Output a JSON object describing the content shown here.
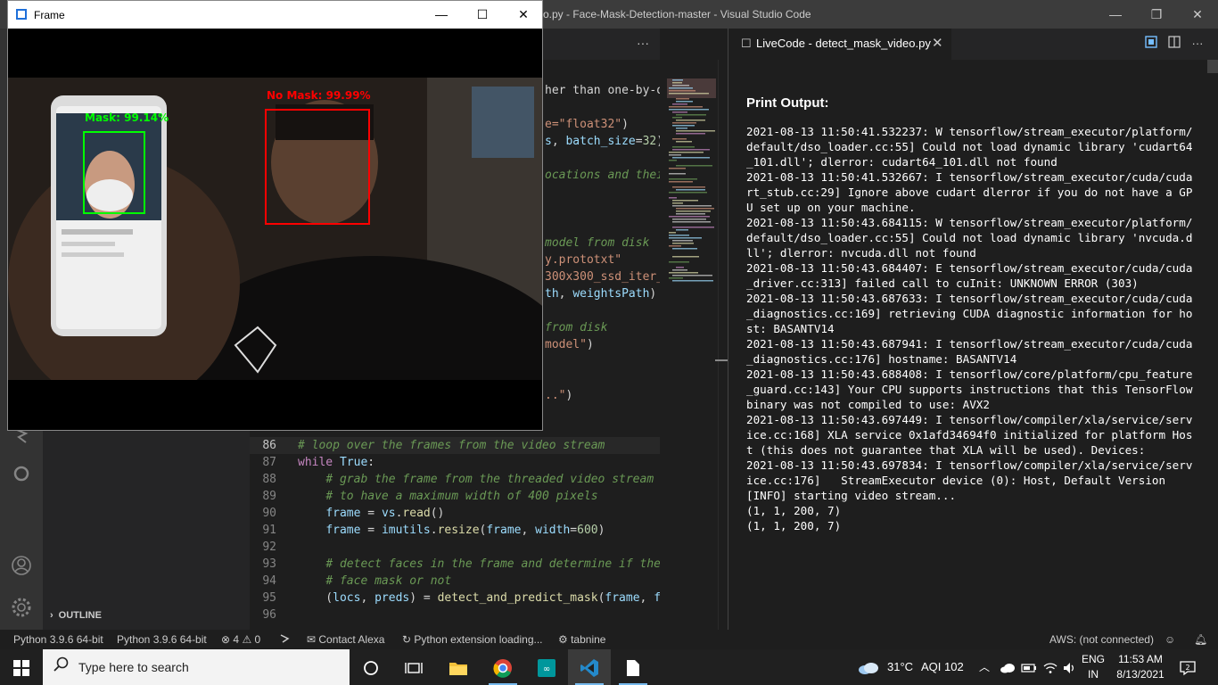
{
  "vscode": {
    "title": "o.py - Face-Mask-Detection-master - Visual Studio Code",
    "window_controls": {
      "minimize": "—",
      "restore": "❐",
      "close": "✕"
    }
  },
  "frame_window": {
    "title": "Frame",
    "controls": {
      "minimize": "—",
      "maximize": "☐",
      "close": "✕"
    },
    "detections": [
      {
        "label": "Mask: 99.14%",
        "color": "#00ff00"
      },
      {
        "label": "No Mask: 99.99%",
        "color": "#ff0000"
      }
    ]
  },
  "editor": {
    "more_actions": "···",
    "hidden_fragments": [
      {
        "parts": [
          [
            "p",
            "her than one-by-o"
          ]
        ]
      },
      {
        "parts": [
          [
            "s",
            "e=\"float32\""
          ],
          [
            "p",
            ")"
          ]
        ]
      },
      {
        "parts": [
          [
            "v",
            "s"
          ],
          [
            "p",
            ", "
          ],
          [
            "v",
            "batch_size"
          ],
          [
            "p",
            "="
          ],
          [
            "n",
            "32"
          ],
          [
            "p",
            ")"
          ]
        ]
      },
      {
        "parts": [
          [
            "c",
            "ocations and thei"
          ]
        ]
      },
      {
        "parts": [
          [
            "c",
            "model from disk"
          ]
        ]
      },
      {
        "parts": [
          [
            "s",
            "y.prototxt\""
          ]
        ]
      },
      {
        "parts": [
          [
            "s",
            "300x300_ssd_iter_"
          ]
        ]
      },
      {
        "parts": [
          [
            "v",
            "th"
          ],
          [
            "p",
            ", "
          ],
          [
            "v",
            "weightsPath"
          ],
          [
            "p",
            ")"
          ]
        ]
      },
      {
        "parts": [
          [
            "c",
            "from disk"
          ]
        ]
      },
      {
        "parts": [
          [
            "s",
            "model\""
          ],
          [
            "p",
            ")"
          ]
        ]
      },
      {
        "parts": [
          [
            "s",
            "..\""
          ],
          [
            "p",
            ")"
          ]
        ]
      }
    ],
    "lines": [
      {
        "num": "86",
        "parts": [
          [
            "c",
            "# loop over the frames from the video stream"
          ]
        ]
      },
      {
        "num": "87",
        "parts": [
          [
            "k",
            "while"
          ],
          [
            "p",
            " "
          ],
          [
            "v",
            "True"
          ],
          [
            "p",
            ":"
          ]
        ]
      },
      {
        "num": "88",
        "parts": [
          [
            "p",
            "    "
          ],
          [
            "c",
            "# grab the frame from the threaded video stream a"
          ]
        ]
      },
      {
        "num": "89",
        "parts": [
          [
            "p",
            "    "
          ],
          [
            "c",
            "# to have a maximum width of 400 pixels"
          ]
        ]
      },
      {
        "num": "90",
        "parts": [
          [
            "p",
            "    "
          ],
          [
            "v",
            "frame"
          ],
          [
            "p",
            " = "
          ],
          [
            "v",
            "vs"
          ],
          [
            "p",
            "."
          ],
          [
            "f",
            "read"
          ],
          [
            "p",
            "()"
          ]
        ]
      },
      {
        "num": "91",
        "parts": [
          [
            "p",
            "    "
          ],
          [
            "v",
            "frame"
          ],
          [
            "p",
            " = "
          ],
          [
            "v",
            "imutils"
          ],
          [
            "p",
            "."
          ],
          [
            "f",
            "resize"
          ],
          [
            "p",
            "("
          ],
          [
            "v",
            "frame"
          ],
          [
            "p",
            ", "
          ],
          [
            "v",
            "width"
          ],
          [
            "p",
            "="
          ],
          [
            "n",
            "600"
          ],
          [
            "p",
            ")"
          ]
        ]
      },
      {
        "num": "92",
        "parts": []
      },
      {
        "num": "93",
        "parts": [
          [
            "p",
            "    "
          ],
          [
            "c",
            "# detect faces in the frame and determine if they"
          ]
        ]
      },
      {
        "num": "94",
        "parts": [
          [
            "p",
            "    "
          ],
          [
            "c",
            "# face mask or not"
          ]
        ]
      },
      {
        "num": "95",
        "parts": [
          [
            "p",
            "    ("
          ],
          [
            "v",
            "locs"
          ],
          [
            "p",
            ", "
          ],
          [
            "v",
            "preds"
          ],
          [
            "p",
            ") = "
          ],
          [
            "f",
            "detect_and_predict_mask"
          ],
          [
            "p",
            "("
          ],
          [
            "v",
            "frame"
          ],
          [
            "p",
            ", "
          ],
          [
            "v",
            "fa"
          ]
        ]
      },
      {
        "num": "96",
        "parts": []
      }
    ]
  },
  "sidebar": {
    "outline_label": "OUTLINE",
    "outline_chevron": "›"
  },
  "live_code": {
    "tab_label": "LiveCode - detect_mask_video.py",
    "heading": "Print Output:",
    "output": "2021-08-13 11:50:41.532237: W tensorflow/stream_executor/platform/default/dso_loader.cc:55] Could not load dynamic library 'cudart64_101.dll'; dlerror: cudart64_101.dll not found\n2021-08-13 11:50:41.532667: I tensorflow/stream_executor/cuda/cudart_stub.cc:29] Ignore above cudart dlerror if you do not have a GPU set up on your machine.\n2021-08-13 11:50:43.684115: W tensorflow/stream_executor/platform/default/dso_loader.cc:55] Could not load dynamic library 'nvcuda.dll'; dlerror: nvcuda.dll not found\n2021-08-13 11:50:43.684407: E tensorflow/stream_executor/cuda/cuda_driver.cc:313] failed call to cuInit: UNKNOWN ERROR (303)\n2021-08-13 11:50:43.687633: I tensorflow/stream_executor/cuda/cuda_diagnostics.cc:169] retrieving CUDA diagnostic information for host: BASANTV14\n2021-08-13 11:50:43.687941: I tensorflow/stream_executor/cuda/cuda_diagnostics.cc:176] hostname: BASANTV14\n2021-08-13 11:50:43.688408: I tensorflow/core/platform/cpu_feature_guard.cc:143] Your CPU supports instructions that this TensorFlow binary was not compiled to use: AVX2\n2021-08-13 11:50:43.697449: I tensorflow/compiler/xla/service/service.cc:168] XLA service 0x1afd34694f0 initialized for platform Host (this does not guarantee that XLA will be used). Devices:\n2021-08-13 11:50:43.697834: I tensorflow/compiler/xla/service/service.cc:176]   StreamExecutor device (0): Host, Default Version\n[INFO] starting video stream...\n(1, 1, 200, 7)\n(1, 1, 200, 7)"
  },
  "statusbar": {
    "python1": "Python 3.9.6 64-bit",
    "python2": "Python 3.9.6 64-bit",
    "errors_icon": "⊗",
    "errors": "4",
    "warnings_icon": "⚠",
    "warnings": "0",
    "contact_alexa": "Contact Alexa",
    "python_loading": "Python extension loading...",
    "tabnine": "tabnine",
    "aws": "AWS: (not connected)"
  },
  "taskbar": {
    "search_placeholder": "Type here to search",
    "temperature": "31°C",
    "aqi": "AQI 102",
    "lang_line1": "ENG",
    "lang_line2": "IN",
    "time": "11:53 AM",
    "date": "8/13/2021",
    "notifications": "2"
  }
}
